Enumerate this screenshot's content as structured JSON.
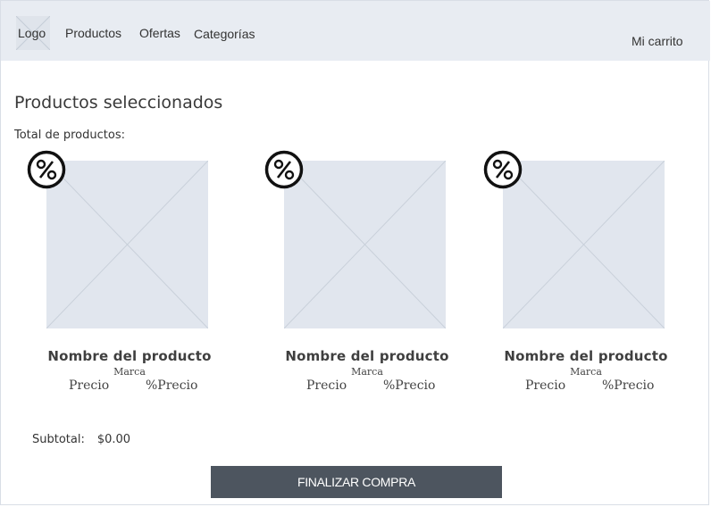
{
  "nav": {
    "logo": "Logo",
    "links": [
      "Productos",
      "Ofertas",
      "Categorías"
    ],
    "cart": "Mi carrito"
  },
  "main": {
    "title": "Productos seleccionados",
    "total_label": "Total de productos:"
  },
  "products": [
    {
      "name": "Nombre del producto",
      "brand": "Marca",
      "price": "Precio",
      "discount_price": "%Precio",
      "badge_icon": "percent-badge-icon"
    },
    {
      "name": "Nombre del producto",
      "brand": "Marca",
      "price": "Precio",
      "discount_price": "%Precio",
      "badge_icon": "percent-badge-icon"
    },
    {
      "name": "Nombre del producto",
      "brand": "Marca",
      "price": "Precio",
      "discount_price": "%Precio",
      "badge_icon": "percent-badge-icon"
    }
  ],
  "summary": {
    "subtotal_label": "Subtotal:",
    "subtotal_value": "$0.00"
  },
  "checkout": {
    "label": "FINALIZAR COMPRA"
  },
  "colors": {
    "navbar_bg": "#e8ecf2",
    "placeholder_bg": "#e1e6ee",
    "button_bg": "#4d555f"
  }
}
